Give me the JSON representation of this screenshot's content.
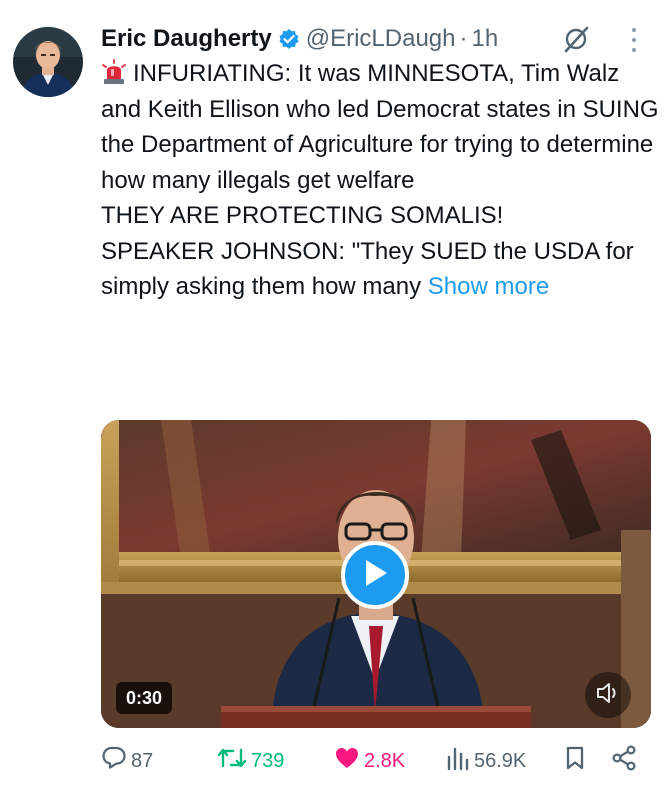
{
  "tweet": {
    "author_name": "Eric Daugherty",
    "handle": "@EricLDaugh",
    "separator": "·",
    "time": "1h",
    "paragraphs": [
      "INFURIATING: It was MINNESOTA, Tim Walz and Keith Ellison who led Democrat states in SUING the Department of Agriculture for trying to determine how many illegals get welfare",
      "THEY ARE PROTECTING SOMALIS!",
      "SPEAKER JOHNSON: \"They SUED the USDA for simply asking them how many"
    ],
    "show_more": "Show more",
    "lead_emoji": "rotating-light-emoji"
  },
  "media": {
    "type": "video",
    "duration": "0:30",
    "play_icon": "play-icon",
    "mute_icon": "speaker-muted-icon"
  },
  "actions": {
    "replies": "87",
    "reposts": "739",
    "likes": "2.8K",
    "views": "56.9K"
  },
  "colors": {
    "accent": "#1d9bf0",
    "repost_active": "#00ba7c",
    "like_active": "#f91880",
    "secondary_text": "#536471"
  }
}
